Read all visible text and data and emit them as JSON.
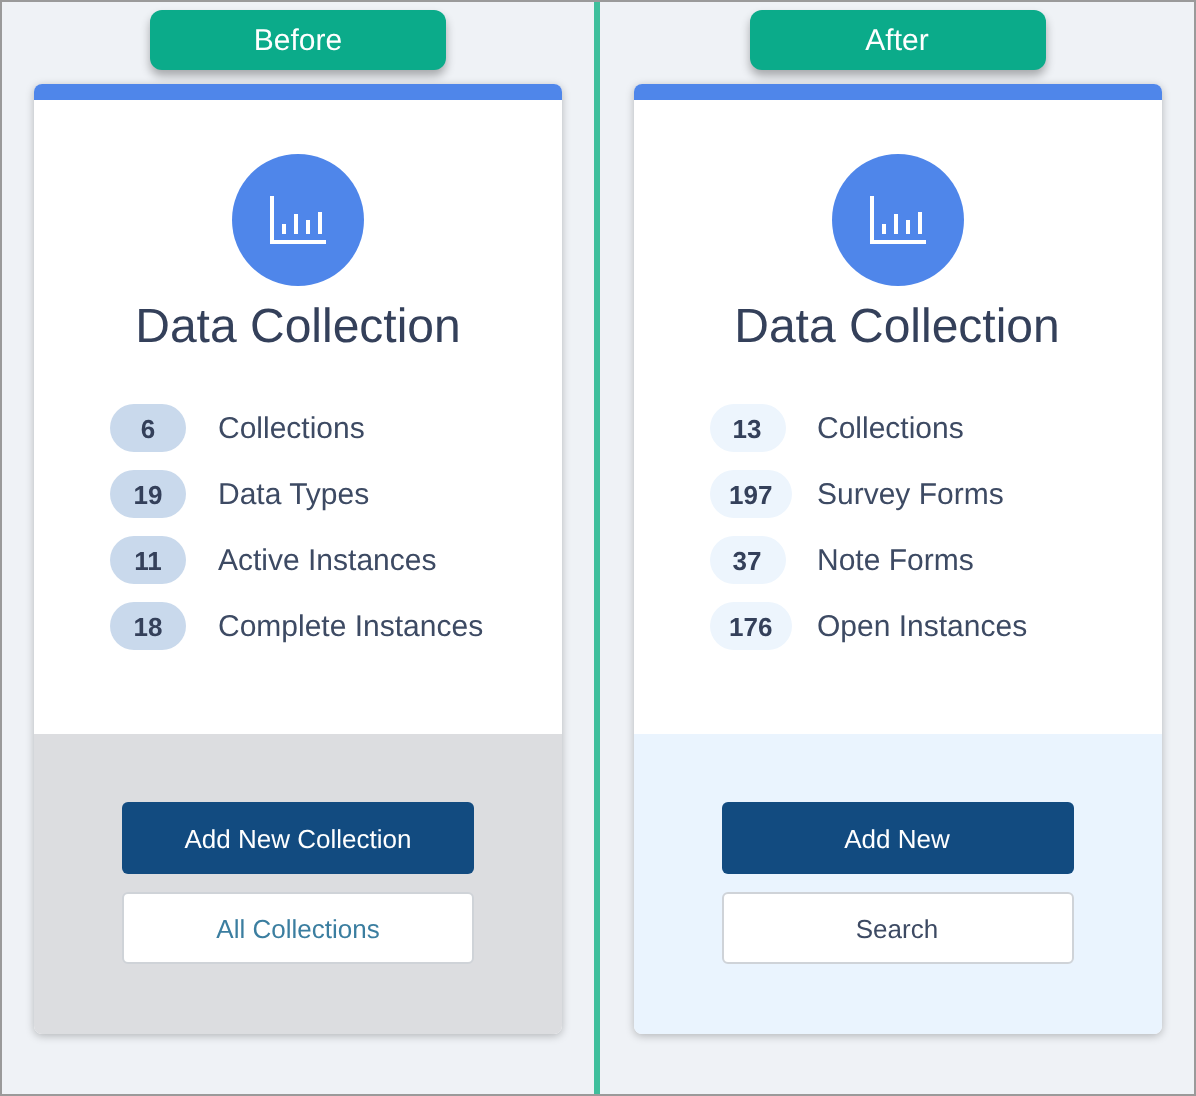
{
  "panels": [
    {
      "kind": "before",
      "label": "Before",
      "card": {
        "title": "Data Collection",
        "stats": [
          {
            "count": "6",
            "label": "Collections"
          },
          {
            "count": "19",
            "label": "Data Types"
          },
          {
            "count": "11",
            "label": "Active Instances"
          },
          {
            "count": "18",
            "label": "Complete Instances"
          }
        ],
        "primary_button": "Add New Collection",
        "secondary_button": "All Collections"
      }
    },
    {
      "kind": "after",
      "label": "After",
      "card": {
        "title": "Data Collection",
        "stats": [
          {
            "count": "13",
            "label": "Collections"
          },
          {
            "count": "197",
            "label": "Survey Forms"
          },
          {
            "count": "37",
            "label": "Note Forms"
          },
          {
            "count": "176",
            "label": "Open Instances"
          }
        ],
        "primary_button": "Add New",
        "secondary_button": "Search"
      }
    }
  ]
}
